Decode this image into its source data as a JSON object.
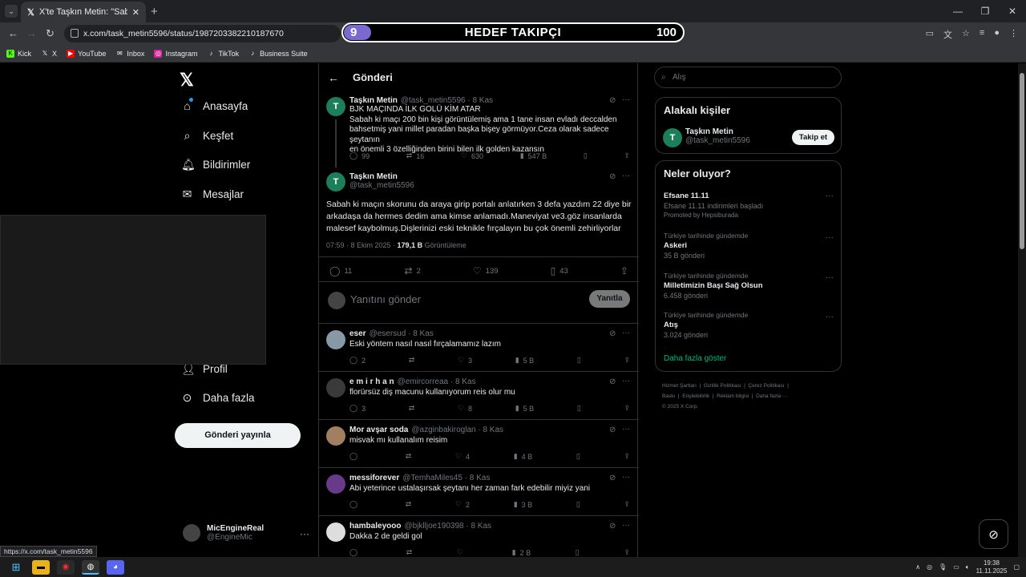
{
  "browser": {
    "tab_title": "X'te Taşkın Metin: \"Sabah ki ma",
    "url": "x.com/task_metin5596/status/1987203382210187670",
    "status_url": "https://x.com/task_metin5596"
  },
  "goal_overlay": {
    "current": "9",
    "title": "HEDEF TAKIPÇI",
    "target": "100"
  },
  "bookmarks": [
    "Kick",
    "X",
    "YouTube",
    "Inbox",
    "Instagram",
    "TikTok",
    "Business Suite"
  ],
  "sidebar": {
    "items": [
      "Anasayfa",
      "Keşfet",
      "Bildirimler",
      "Mesajlar",
      "Profil",
      "Daha fazla"
    ],
    "post_button": "Gönderi yayınla",
    "account_name": "MicEngineReal",
    "account_handle": "@EngineMic"
  },
  "main": {
    "title": "Gönderi",
    "quoted": {
      "name": "Taşkın Metin",
      "handle": "@task_metin5596 · 8 Kas",
      "lines": [
        "BJK MAÇINDA İLK GOLÜ KİM ATAR",
        "Sabah ki maçı 200 bin kişi görüntülemiş ama 1 tane insan evladı deccalden",
        "bahsetmiş yani millet paradan başka bişey görmüyor.Ceza olarak sadece şeytanın",
        "en önemli 3 özelliğinden birini bilen ilk golden kazansın"
      ],
      "replies": "99",
      "reposts": "16",
      "likes": "630",
      "views": "547 B"
    },
    "post": {
      "name": "Taşkın Metin",
      "handle": "@task_metin5596",
      "lines": [
        "Sabah ki maçın skorunu da araya girip portalı anlatırken 3 defa yazdım 22 diye bir",
        "arkadaşa da hermes dedim ama kimse anlamadı.Maneviyat ve3.göz insanlarda",
        "malesef kaybolmuş.Dişlerinizi eski teknikle fırçalayın bu çok önemli zehirliyorlar"
      ],
      "time": "07:59 · 8 Ekim 2025 · ",
      "views_count": "179,1 B",
      "views_label": " Görüntüleme",
      "replies": "11",
      "reposts": "2",
      "likes": "139",
      "bookmarks": "43"
    },
    "reply_placeholder": "Yanıtını gönder",
    "reply_button": "Yanıtla",
    "replies": [
      {
        "name": "eser",
        "handle": "@esersud · 8 Kas",
        "text": "Eski yöntem nasıl nasıl fırçalamamız lazım",
        "replies": "2",
        "likes": "3",
        "views": "5 B",
        "color": "#8899a6"
      },
      {
        "name": "e m i r h a n",
        "handle": "@emircorreaa · 8 Kas",
        "text": "florürsüz diş macunu kullanıyorum reis olur mu",
        "replies": "3",
        "likes": "8",
        "views": "5 B",
        "color": "#3a3a3a"
      },
      {
        "name": "Mor avşar soda",
        "handle": "@azginbakiroglan · 8 Kas",
        "text": "misvak mı kullanalım reisim",
        "replies": "",
        "likes": "4",
        "views": "4 B",
        "color": "#a08060"
      },
      {
        "name": "messiforever",
        "handle": "@TemhaMiles45 · 8 Kas",
        "text": "Abi yeterince ustalaşırsak şeytanı her zaman fark edebilir miyiz yani",
        "replies": "",
        "likes": "2",
        "views": "3 B",
        "color": "#6a3a8a"
      },
      {
        "name": "hambaleyooo",
        "handle": "@bjklljoe190398 · 8 Kas",
        "text": "Dakka 2 de geldi gol",
        "replies": "",
        "likes": "",
        "views": "2 B",
        "color": "#dddddd"
      }
    ]
  },
  "right": {
    "search_placeholder": "Alış",
    "who_title": "Alakalı kişiler",
    "who_name": "Taşkın Metin",
    "who_handle": "@task_metin5596",
    "follow": "Takip et",
    "trends_title": "Neler oluyor?",
    "trends": [
      {
        "meta": "",
        "name": "Efsane 11.11",
        "sub": "Efsane 11.11 indirimleri başladı",
        "extra": "Promoted by Hepsiburada"
      },
      {
        "meta": "Türkiye tarihinde gündemde",
        "name": "Askeri",
        "sub": "35 B gönderi",
        "extra": ""
      },
      {
        "meta": "Türkiye tarihinde gündemde",
        "name": "Milletimizin Başı Sağ Olsun",
        "sub": "6.458 gönderi",
        "extra": ""
      },
      {
        "meta": "Türkiye tarihinde gündemde",
        "name": "Atış",
        "sub": "3.024 gönderi",
        "extra": ""
      }
    ],
    "show_more": "Daha fazla göster",
    "footer": [
      "Hizmet Şartları",
      "Gizlilik Politikası",
      "Çerez Politikası",
      "Baskı",
      "Erişilebilirlik",
      "Reklam bilgisi",
      "Daha fazla ···",
      "© 2025 X Corp."
    ]
  },
  "taskbar": {
    "time": "19:38",
    "date": "11.11.2025"
  },
  "colors": {
    "accent": "#1d9bf0",
    "avatar_T": "#1a7f5a",
    "green_link": "#00ba7c",
    "goal_fill": "#7a6ad0"
  }
}
